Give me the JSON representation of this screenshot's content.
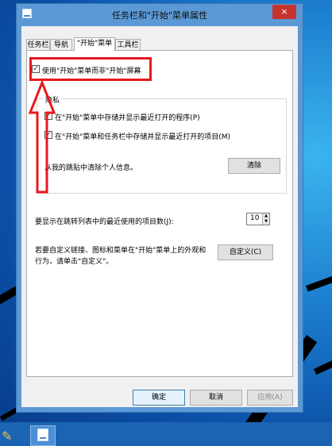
{
  "window": {
    "title": "任务栏和\"开始\"菜单属性",
    "close_glyph": "×"
  },
  "tabs": [
    {
      "label": "任务栏"
    },
    {
      "label": "导航"
    },
    {
      "label": "\"开始\"菜单",
      "active": true
    },
    {
      "label": "工具栏"
    }
  ],
  "options": {
    "use_start_menu": {
      "label": "使用\"开始\"菜单而非\"开始\"屏幕",
      "checked": true
    },
    "privacy": {
      "title": "隐私",
      "store_programs": {
        "label": "在\"开始\"菜单中存储并显示最近打开的程序(P)",
        "checked": true
      },
      "store_items": {
        "label": "在\"开始\"菜单和任务栏中存储并显示最近打开的项目(M)",
        "checked": true
      },
      "clear_text": "从我的跳贴中清除个人信息。",
      "clear_button": "清除"
    },
    "jumplist": {
      "label": "要显示在跳转列表中的最近使用的项目数(J):",
      "value": "10"
    },
    "customize": {
      "text_line1": "若要自定义链接、图标和菜单在\"开始\"菜单上的外观和",
      "text_line2": "行为，请单击\"自定义\"。",
      "button": "自定义(C)"
    }
  },
  "footer": {
    "ok": "确定",
    "cancel": "取消",
    "apply": "应用(A)"
  },
  "checkmark_glyph": "✓",
  "colors": {
    "annotation": "#e8181e",
    "titlebar": "#5b99d6",
    "close": "#c7312e",
    "taskbar": "#1b64b4"
  }
}
